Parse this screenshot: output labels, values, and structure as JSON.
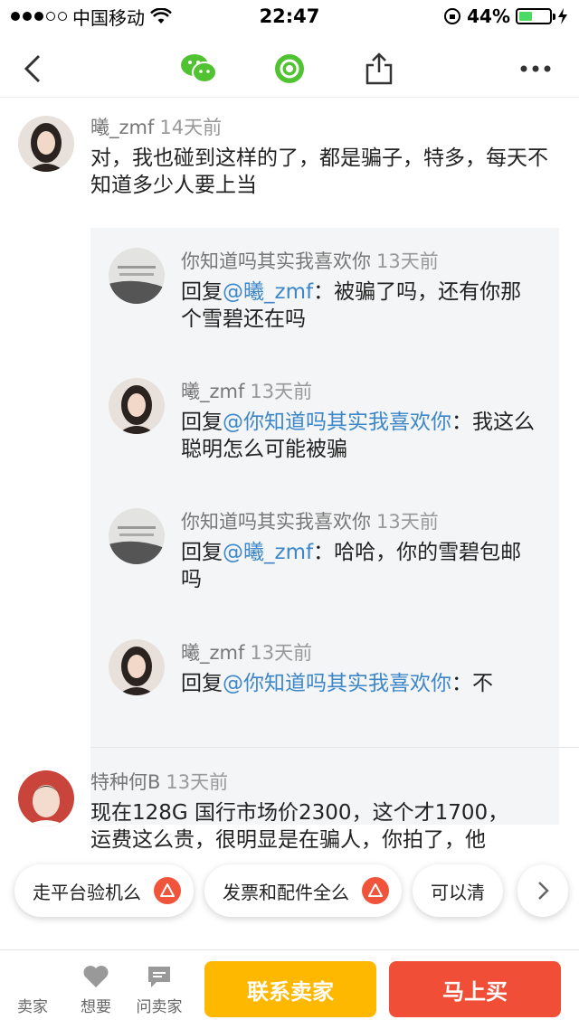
{
  "status_bar": {
    "carrier": "中国移动",
    "time": "22:47",
    "battery": "44%",
    "battery_level": 0.44
  },
  "comments": [
    {
      "user": "曦_zmf",
      "time": "14天前",
      "text": "对，我也碰到这样的了，都是骗子，特多，每天不知道多少人要上当",
      "replies": [
        {
          "user": "你知道吗其实我喜欢你",
          "time": "13天前",
          "prefix": "回复",
          "mention": "@曦_zmf",
          "text": "：被骗了吗，还有你那个雪碧还在吗"
        },
        {
          "user": "曦_zmf",
          "time": "13天前",
          "prefix": "回复",
          "mention": "@你知道吗其实我喜欢你",
          "text": "：我这么聪明怎么可能被骗"
        },
        {
          "user": "你知道吗其实我喜欢你",
          "time": "13天前",
          "prefix": "回复",
          "mention": "@曦_zmf",
          "text": "：哈哈，你的雪碧包邮吗"
        },
        {
          "user": "曦_zmf",
          "time": "13天前",
          "prefix": "回复",
          "mention": "@你知道吗其实我喜欢你",
          "text": "：不"
        }
      ]
    },
    {
      "user": "特种何B",
      "time": "13天前",
      "text_line1": "现在128G 国行市场价2300，这个才1700，",
      "text_line2": "运费这么贵，很明显是在骗人，你拍了，他"
    }
  ],
  "chips": [
    {
      "label": "走平台验机么"
    },
    {
      "label": "发票和配件全么"
    },
    {
      "label": "可以清"
    }
  ],
  "bottom_bar": {
    "tabs": [
      {
        "label": "卖家"
      },
      {
        "label": "想要"
      },
      {
        "label": "问卖家"
      }
    ],
    "contact_label": "联系卖家",
    "buy_label": "马上买"
  },
  "colors": {
    "accent_yellow": "#ffb800",
    "accent_red": "#f04e36",
    "mention_blue": "#3d87c9",
    "wechat_green": "#51c332"
  }
}
